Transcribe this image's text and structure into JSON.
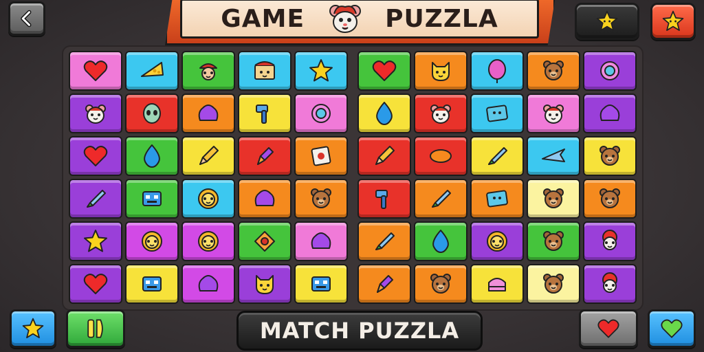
{
  "header": {
    "title_word_1": "GAME",
    "title_word_2": "PUZZLA",
    "mascot_icon": "hamster-mascot-icon"
  },
  "footer": {
    "match_label": "MATCH PUZZLA"
  },
  "colors": {
    "pink": "#f07ad8",
    "cyan": "#3cc8f0",
    "green": "#45c43c",
    "yellow": "#f7e23a",
    "purple": "#9a3fd9",
    "red": "#e8322a",
    "orange": "#f58a1e",
    "lime": "#6fd64a",
    "magenta": "#d24ae6",
    "lightyellow": "#fbf3a0"
  },
  "board": {
    "left": [
      [
        {
          "color": "pink",
          "icon": "heart"
        },
        {
          "color": "cyan",
          "icon": "cheese"
        },
        {
          "color": "green",
          "icon": "pirate"
        },
        {
          "color": "cyan",
          "icon": "chest"
        },
        {
          "color": "cyan",
          "icon": "star"
        }
      ],
      [
        {
          "color": "purple",
          "icon": "hamster"
        },
        {
          "color": "red",
          "icon": "alien"
        },
        {
          "color": "orange",
          "icon": "blob"
        },
        {
          "color": "yellow",
          "icon": "hammer"
        },
        {
          "color": "pink",
          "icon": "ring"
        }
      ],
      [
        {
          "color": "purple",
          "icon": "heart"
        },
        {
          "color": "green",
          "icon": "drop"
        },
        {
          "color": "yellow",
          "icon": "pencil"
        },
        {
          "color": "red",
          "icon": "crayon"
        },
        {
          "color": "orange",
          "icon": "card"
        }
      ],
      [
        {
          "color": "purple",
          "icon": "pen"
        },
        {
          "color": "green",
          "icon": "robot"
        },
        {
          "color": "cyan",
          "icon": "lion"
        },
        {
          "color": "orange",
          "icon": "blob"
        },
        {
          "color": "orange",
          "icon": "bear"
        }
      ],
      [
        {
          "color": "purple",
          "icon": "star"
        },
        {
          "color": "magenta",
          "icon": "lion"
        },
        {
          "color": "magenta",
          "icon": "lion"
        },
        {
          "color": "green",
          "icon": "top"
        },
        {
          "color": "pink",
          "icon": "blob"
        }
      ],
      [
        {
          "color": "purple",
          "icon": "heart"
        },
        {
          "color": "yellow",
          "icon": "robot"
        },
        {
          "color": "magenta",
          "icon": "blob"
        },
        {
          "color": "purple",
          "icon": "cat"
        },
        {
          "color": "yellow",
          "icon": "robot"
        }
      ]
    ],
    "right": [
      [
        {
          "color": "green",
          "icon": "heart"
        },
        {
          "color": "orange",
          "icon": "cat"
        },
        {
          "color": "cyan",
          "icon": "balloon"
        },
        {
          "color": "orange",
          "icon": "bear"
        },
        {
          "color": "purple",
          "icon": "ring"
        }
      ],
      [
        {
          "color": "yellow",
          "icon": "drop"
        },
        {
          "color": "red",
          "icon": "hamster"
        },
        {
          "color": "cyan",
          "icon": "ticket"
        },
        {
          "color": "pink",
          "icon": "hamster"
        },
        {
          "color": "purple",
          "icon": "blob"
        }
      ],
      [
        {
          "color": "red",
          "icon": "pencil"
        },
        {
          "color": "red",
          "icon": "bean"
        },
        {
          "color": "yellow",
          "icon": "pen"
        },
        {
          "color": "cyan",
          "icon": "plane"
        },
        {
          "color": "yellow",
          "icon": "bear"
        }
      ],
      [
        {
          "color": "red",
          "icon": "hammer"
        },
        {
          "color": "orange",
          "icon": "pen"
        },
        {
          "color": "orange",
          "icon": "ticket"
        },
        {
          "color": "lightyellow",
          "icon": "bear"
        },
        {
          "color": "orange",
          "icon": "bear"
        }
      ],
      [
        {
          "color": "orange",
          "icon": "pen"
        },
        {
          "color": "green",
          "icon": "drop"
        },
        {
          "color": "purple",
          "icon": "lion"
        },
        {
          "color": "green",
          "icon": "bear"
        },
        {
          "color": "purple",
          "icon": "clown"
        }
      ],
      [
        {
          "color": "orange",
          "icon": "crayon"
        },
        {
          "color": "orange",
          "icon": "bear"
        },
        {
          "color": "yellow",
          "icon": "cake"
        },
        {
          "color": "lightyellow",
          "icon": "bear"
        },
        {
          "color": "purple",
          "icon": "clown"
        }
      ]
    ]
  }
}
